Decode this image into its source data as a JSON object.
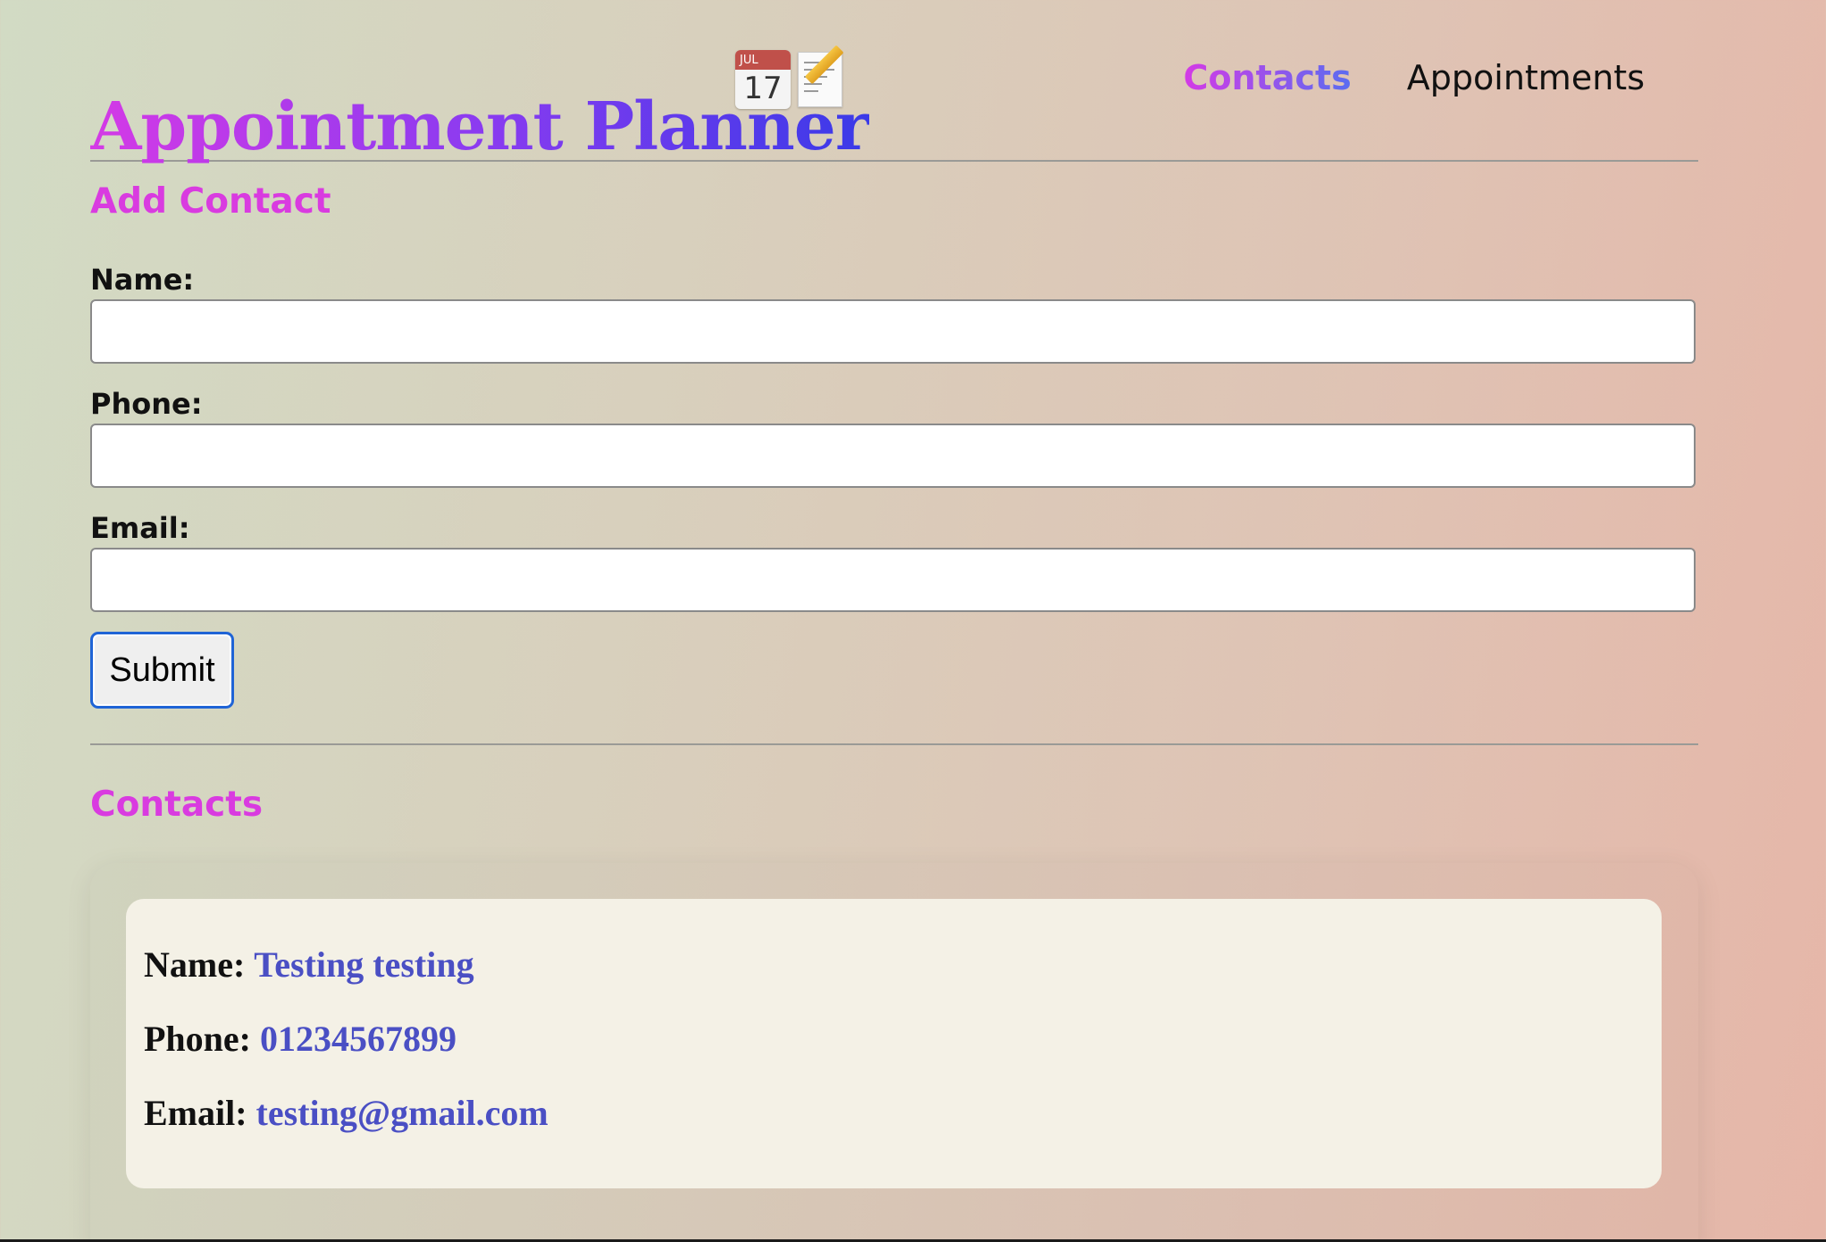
{
  "header": {
    "title": "Appointment Planner",
    "calendar_icon": {
      "month": "JUL",
      "day": "17"
    },
    "memo_icon": "memo-icon",
    "nav": [
      {
        "label": "Contacts",
        "active": true
      },
      {
        "label": "Appointments",
        "active": false
      }
    ]
  },
  "add_contact": {
    "title": "Add Contact",
    "fields": [
      {
        "label": "Name:",
        "value": "",
        "placeholder": ""
      },
      {
        "label": "Phone:",
        "value": "",
        "placeholder": ""
      },
      {
        "label": "Email:",
        "value": "",
        "placeholder": ""
      }
    ],
    "submit_label": "Submit"
  },
  "contacts": {
    "title": "Contacts",
    "items": [
      {
        "name_label": "Name:",
        "name": "Testing testing",
        "phone_label": "Phone:",
        "phone": "01234567899",
        "email_label": "Email:",
        "email": "testing@gmail.com"
      }
    ]
  },
  "colors": {
    "accent": "#d93be0",
    "title_gradient_start": "#d43ae6",
    "title_gradient_end": "#3a3ae8",
    "value_text": "#4a4fc4",
    "focus_ring": "#1f64d6"
  }
}
